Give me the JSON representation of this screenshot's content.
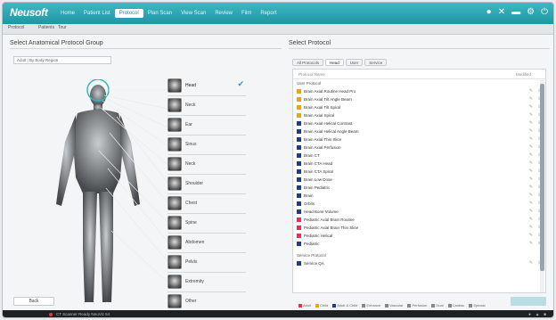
{
  "app": {
    "logo": "Neusoft"
  },
  "menu": [
    {
      "label": "Home",
      "active": false
    },
    {
      "label": "Patient List",
      "active": false
    },
    {
      "label": "Protocol",
      "active": true
    },
    {
      "label": "Plan Scan",
      "active": false
    },
    {
      "label": "View Scan",
      "active": false
    },
    {
      "label": "Review",
      "active": false
    },
    {
      "label": "Film",
      "active": false
    },
    {
      "label": "Report",
      "active": false
    }
  ],
  "toolbar": {
    "items": [
      "Protocol",
      "Patients",
      "Tour"
    ]
  },
  "left": {
    "title": "Select Anatomical Protocol Group",
    "select_value": "Adult | By Body Region",
    "back_label": "Back"
  },
  "regions": [
    {
      "label": "Head",
      "selected": true
    },
    {
      "label": "Neck",
      "selected": false
    },
    {
      "label": "Ear",
      "selected": false
    },
    {
      "label": "Sinus",
      "selected": false
    },
    {
      "label": "Neck",
      "selected": false
    },
    {
      "label": "Shoulder",
      "selected": false
    },
    {
      "label": "Chest",
      "selected": false
    },
    {
      "label": "Spine",
      "selected": false
    },
    {
      "label": "Abdomen",
      "selected": false
    },
    {
      "label": "Pelvis",
      "selected": false
    },
    {
      "label": "Extremity",
      "selected": false
    },
    {
      "label": "Other",
      "selected": false
    }
  ],
  "right": {
    "title": "Select Protocol",
    "tabs": [
      {
        "label": "All Protocols",
        "active": false
      },
      {
        "label": "Head",
        "active": true
      },
      {
        "label": "User",
        "active": false
      },
      {
        "label": "Service",
        "active": false
      }
    ],
    "list_header": "Protocol Name",
    "list_header_right": "Modified",
    "group_user": "User Protocol",
    "group_service": "Service Protocol",
    "protocols": [
      {
        "name": "Brain Axial Routine Head Pro",
        "color": "#f0a020"
      },
      {
        "name": "Brain Axial Tilt Angle Beam",
        "color": "#f0a020"
      },
      {
        "name": "Brain Axial Tilt Spiral",
        "color": "#f0a020"
      },
      {
        "name": "Brain Axial Spiral",
        "color": "#f0a020"
      },
      {
        "name": "Brain Axial Helical Contrast",
        "color": "#1f3a93"
      },
      {
        "name": "Brain Axial Helical Angle Beam",
        "color": "#1f3a93"
      },
      {
        "name": "Brain Axial Thin Slice",
        "color": "#1f3a93"
      },
      {
        "name": "Brain Axial Perfusion",
        "color": "#1f3a93"
      },
      {
        "name": "Brain CT",
        "color": "#1f3a93"
      },
      {
        "name": "Brain CTA Head",
        "color": "#1f3a93"
      },
      {
        "name": "Brain CTA Spiral",
        "color": "#1f3a93"
      },
      {
        "name": "Brain Low Dose",
        "color": "#1f3a93"
      },
      {
        "name": "Brain Pediatric",
        "color": "#1f3a93"
      },
      {
        "name": "Brain",
        "color": "#1f3a93"
      },
      {
        "name": "Orbits",
        "color": "#1f3a93"
      },
      {
        "name": "Head Bone Volume",
        "color": "#1f3a93"
      },
      {
        "name": "Pediatric Axial Brain Routine",
        "color": "#e8304a"
      },
      {
        "name": "Pediatric Axial Brain Thin Slice",
        "color": "#e8304a"
      },
      {
        "name": "Pediatric Helical",
        "color": "#e8304a"
      },
      {
        "name": "Pediatric",
        "color": "#1f3a93"
      }
    ],
    "service_protocols": [
      {
        "name": "Service QA",
        "color": "#1f3a93"
      }
    ],
    "legend": [
      "Adult",
      "Child",
      "Adult & Child",
      "Enhance",
      "Vascular",
      "Perfusion",
      "Dual",
      "Cardiac",
      "Special"
    ]
  },
  "status": {
    "text": "CT Scanner  Ready  NeuViz 64"
  }
}
